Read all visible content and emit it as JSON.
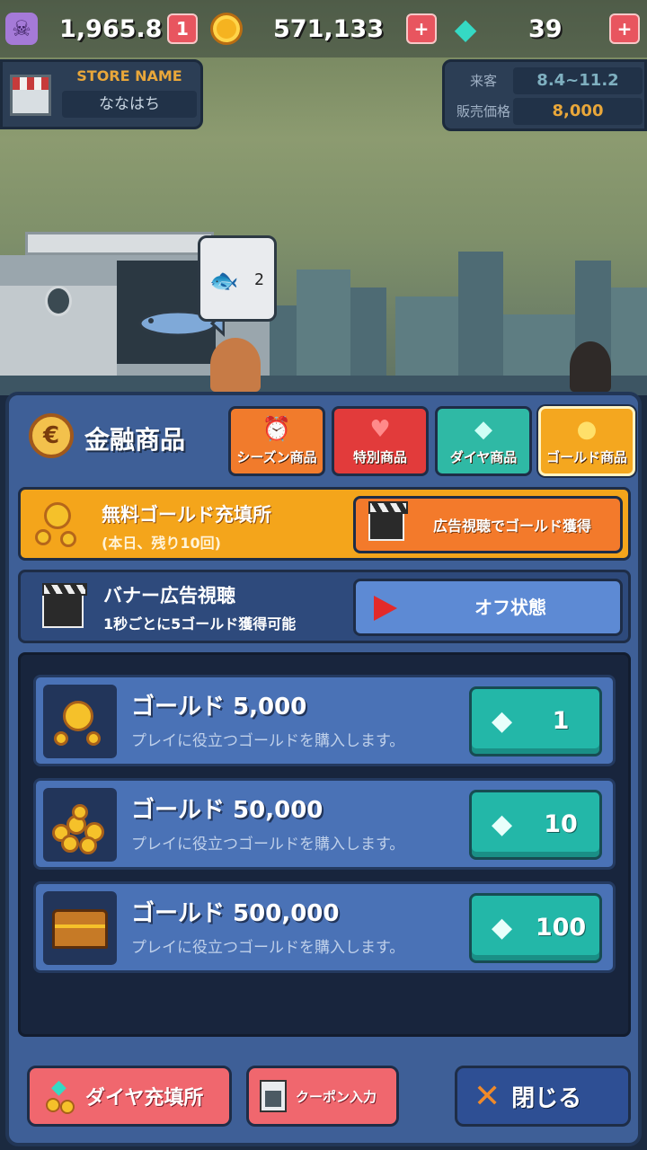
{
  "hud": {
    "skull_value": "1,965.8",
    "skull_badge": "1",
    "gold_value": "571,133",
    "gem_value": "39",
    "plus": "+"
  },
  "store": {
    "label": "STORE NAME",
    "name": "ななはち"
  },
  "stats": {
    "visitors_label": "来客",
    "visitors_value": "8.4~11.2",
    "price_label": "販売価格",
    "price_value": "8,000"
  },
  "scene": {
    "bubble_count": "2"
  },
  "panel": {
    "title": "金融商品",
    "tabs": [
      {
        "label": "シーズン商品",
        "icon": "alarm-clock-icon"
      },
      {
        "label": "特別商品",
        "icon": "heart-icon"
      },
      {
        "label": "ダイヤ商品",
        "icon": "diamond-icon"
      },
      {
        "label": "ゴールド商品",
        "icon": "coin-icon"
      }
    ],
    "free_gold": {
      "title": "無料ゴールド充填所",
      "subtitle": "(本日、残り10回)",
      "button_label": "広告視聴でゴールド獲得"
    },
    "banner": {
      "title": "バナー広告視聴",
      "subtitle": "1秒ごとに5ゴールド獲得可能",
      "button_label": "オフ状態"
    },
    "items": [
      {
        "name": "ゴールド 5,000",
        "description": "プレイに役立つゴールドを購入します。",
        "price": "1"
      },
      {
        "name": "ゴールド 50,000",
        "description": "プレイに役立つゴールドを購入します。",
        "price": "10"
      },
      {
        "name": "ゴールド 500,000",
        "description": "プレイに役立つゴールドを購入します。",
        "price": "100"
      }
    ]
  },
  "bottom": {
    "diamond_label": "ダイヤ充填所",
    "coupon_label": "クーポン入力",
    "close_label": "閉じる"
  },
  "colors": {
    "panel": "#3e5f97",
    "accent_orange": "#f4a51b",
    "teal": "#23b7a8",
    "red": "#e23b3b"
  }
}
